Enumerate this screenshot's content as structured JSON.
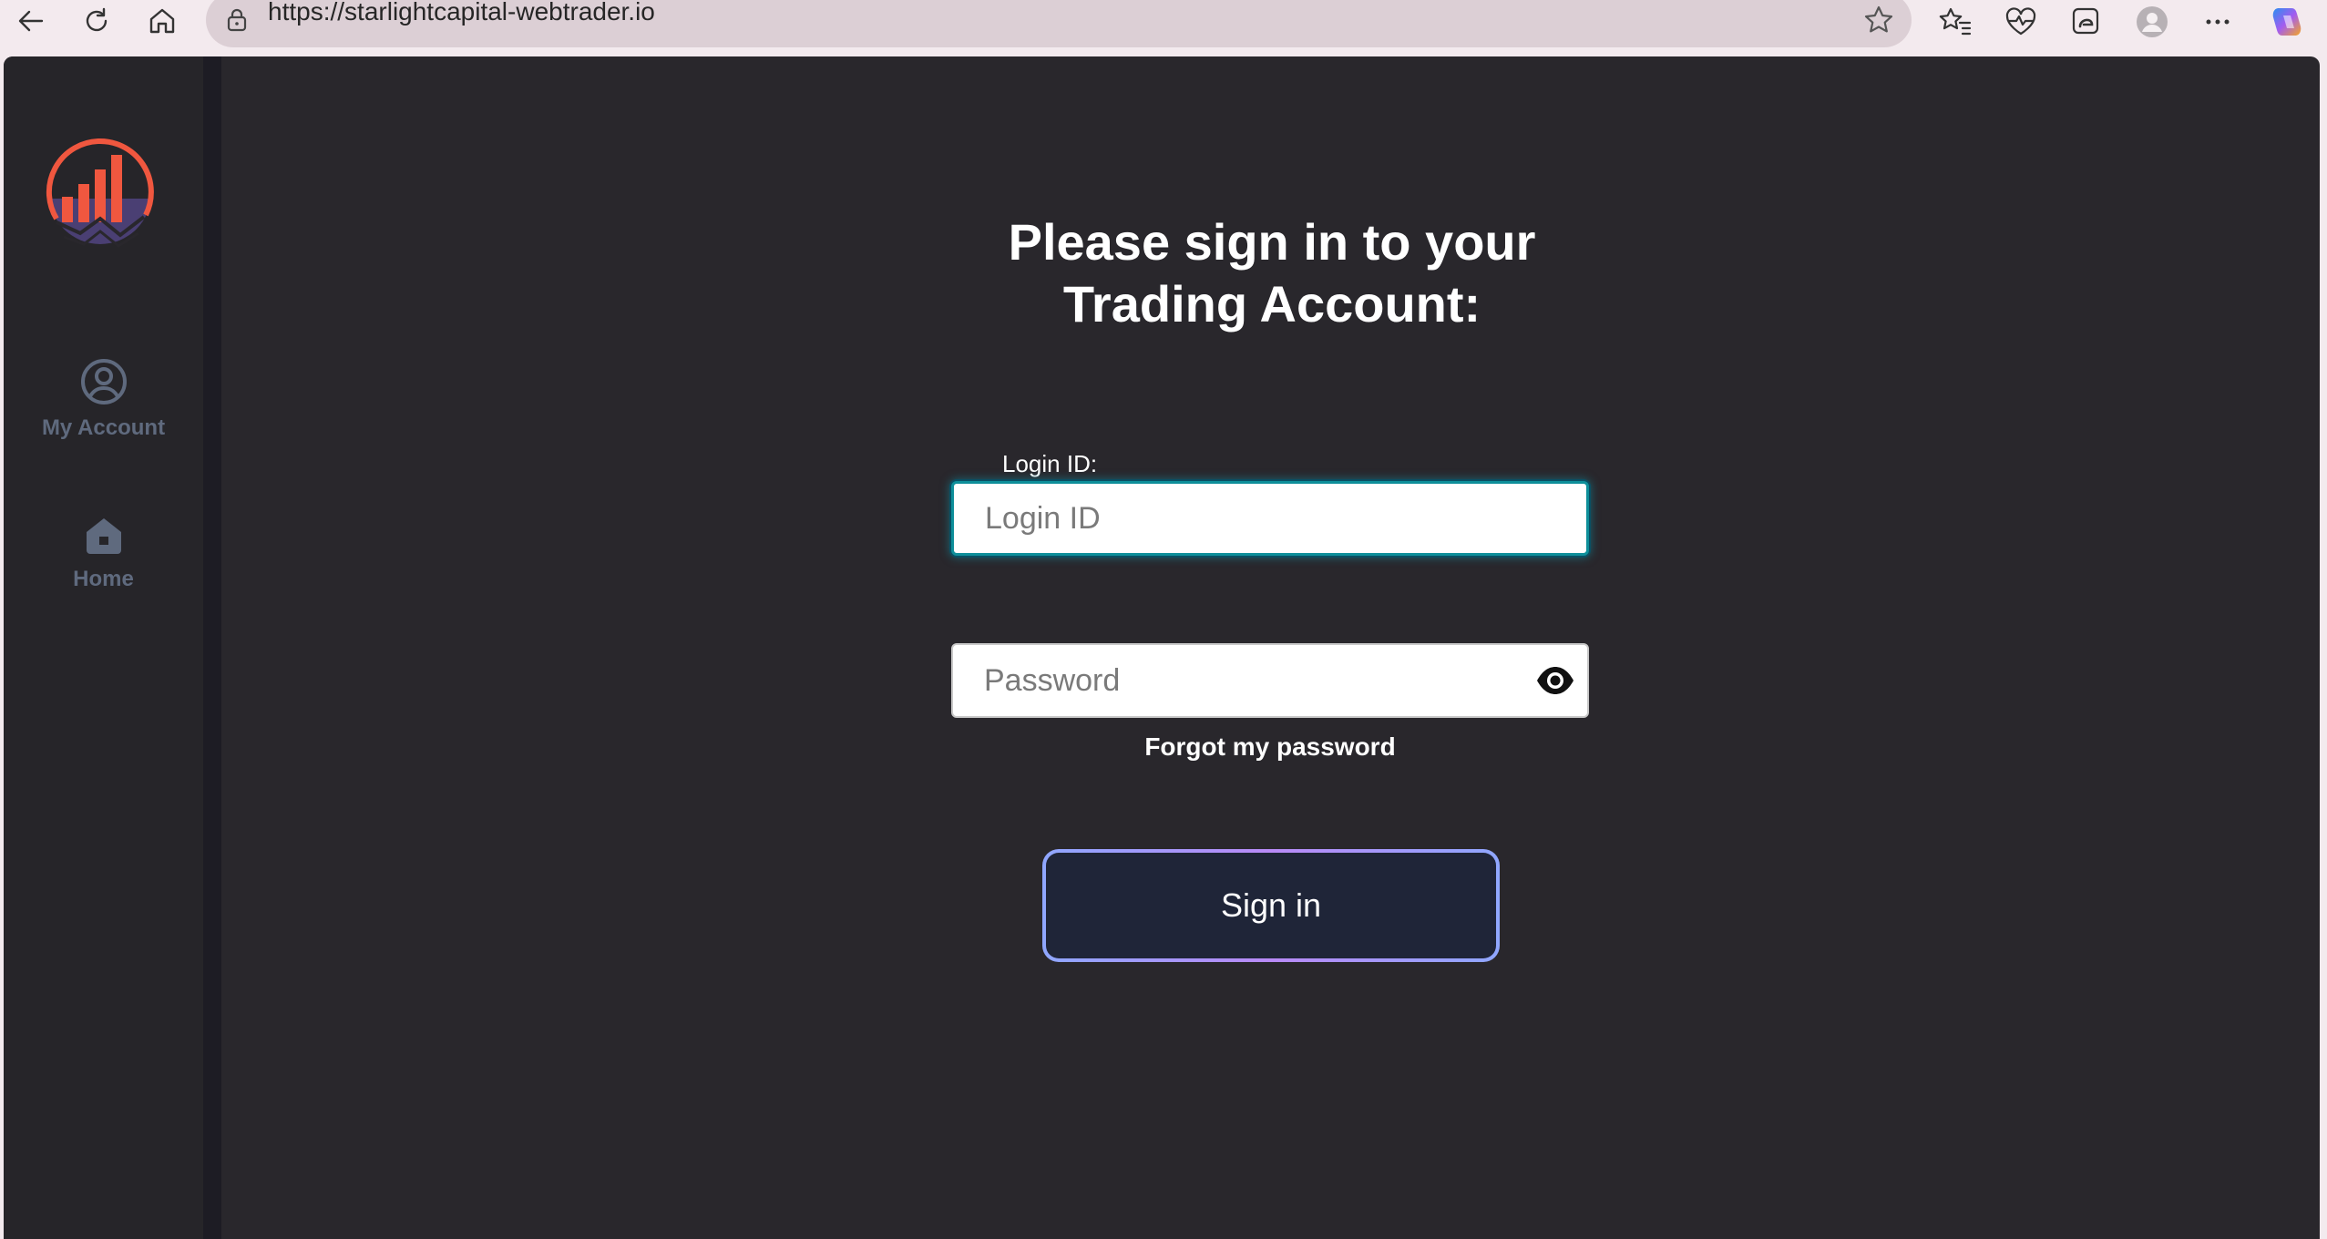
{
  "browser": {
    "url": "https://starlightcapital-webtrader.io",
    "icons": [
      "back-icon",
      "refresh-icon",
      "home-icon",
      "lock-icon",
      "star-icon",
      "favorites-icon",
      "health-icon",
      "collections-icon",
      "profile-icon",
      "more-icon",
      "copilot-icon"
    ]
  },
  "sidebar": {
    "items": [
      {
        "label": "My Account",
        "icon": "user-circle-icon"
      },
      {
        "label": "Home",
        "icon": "house-icon"
      }
    ]
  },
  "login": {
    "heading_line1": "Please sign in to your",
    "heading_line2": "Trading Account:",
    "login_label": "Login ID:",
    "login_placeholder": "Login ID",
    "password_placeholder": "Password",
    "forgot": "Forgot my password",
    "signin": "Sign in"
  },
  "colors": {
    "page_bg": "#29272c",
    "sidebar_bg": "#262529",
    "accent_orange": "#f0573f",
    "accent_purple": "#4a3f73",
    "focus_ring": "#0e8f9a",
    "button_bg": "#1f2538"
  }
}
